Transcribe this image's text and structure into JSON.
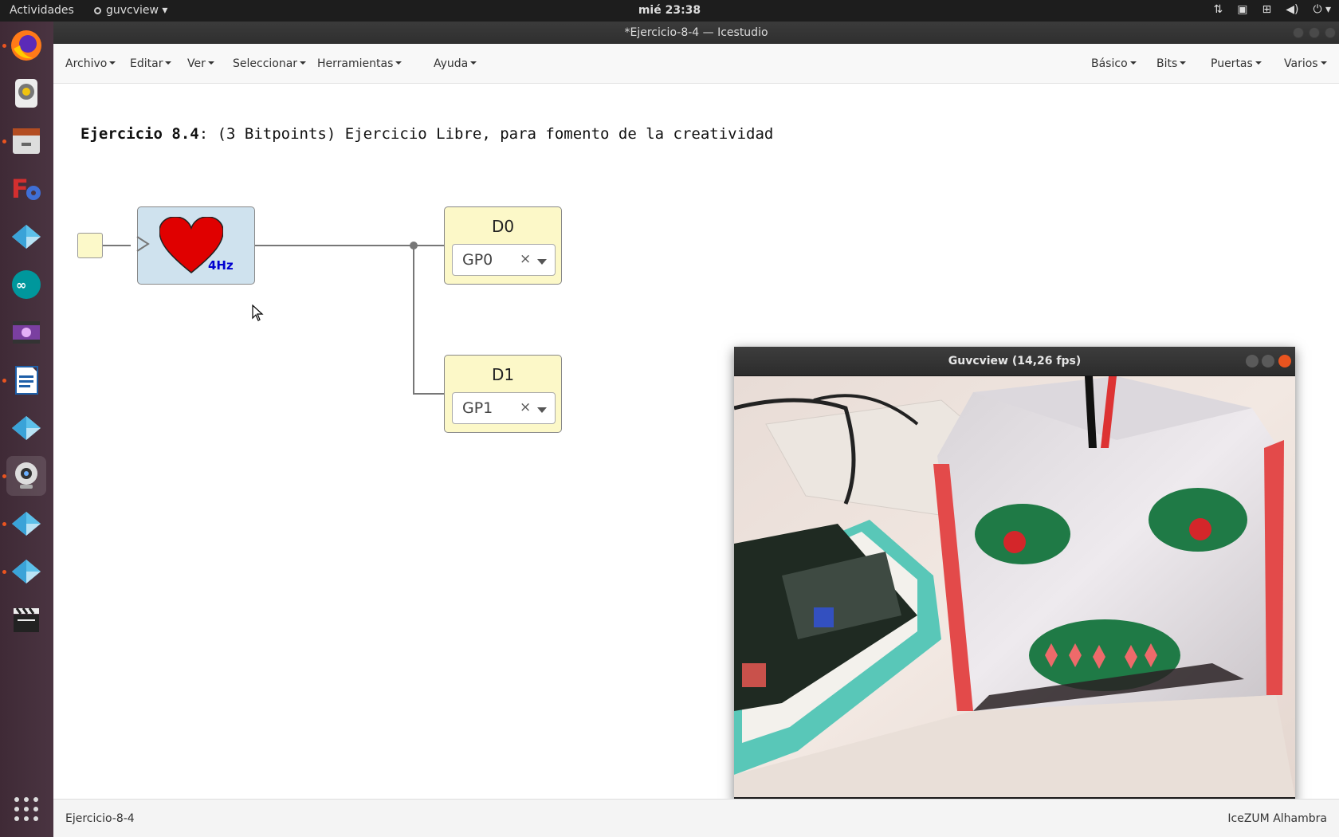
{
  "topbar": {
    "activities": "Actividades",
    "app_name": "guvcview",
    "clock": "mié 23:38",
    "tray_icons": [
      "network-transfer-icon",
      "camera-icon",
      "network-icon",
      "volume-icon",
      "power-icon"
    ]
  },
  "window": {
    "title": "*Ejercicio-8-4 — Icestudio"
  },
  "launcher": {
    "items": [
      {
        "name": "firefox-icon",
        "running": true
      },
      {
        "name": "rhythmbox-icon",
        "running": false
      },
      {
        "name": "files-icon",
        "running": true
      },
      {
        "name": "freecad-icon",
        "running": false
      },
      {
        "name": "icestudio-icon",
        "running": false
      },
      {
        "name": "arduino-icon",
        "running": false
      },
      {
        "name": "video-editor-icon",
        "running": false
      },
      {
        "name": "writer-icon",
        "running": true
      },
      {
        "name": "icestudio-icon",
        "running": false
      },
      {
        "name": "webcam-icon",
        "running": true
      },
      {
        "name": "icestudio-icon",
        "running": true
      },
      {
        "name": "icestudio-icon",
        "running": true
      },
      {
        "name": "clapper-icon",
        "running": false
      }
    ],
    "show_apps": "app-grid-icon"
  },
  "menu": {
    "left": [
      "Archivo",
      "Editar",
      "Ver",
      "Seleccionar",
      "Herramientas",
      "Ayuda"
    ],
    "right": [
      "Básico",
      "Bits",
      "Puertas",
      "Varios"
    ]
  },
  "canvas": {
    "heading_bold": "Ejercicio 8.4",
    "heading_rest": ": (3 Bitpoints) Ejercicio Libre, para fomento de la creatividad",
    "heart_freq": "4Hz",
    "outputs": [
      {
        "label": "D0",
        "pin": "GP0",
        "clear": "×"
      },
      {
        "label": "D1",
        "pin": "GP1",
        "clear": "×"
      }
    ]
  },
  "guvcview": {
    "title": "Guvcview  (14,26 fps)"
  },
  "status": {
    "left": "Ejercicio-8-4",
    "right": "IceZUM Alhambra"
  },
  "colors": {
    "orange_pip": "#e95420",
    "heart": "#e00000",
    "freq_text": "#0000d0",
    "block_blue": "#cfe2ee",
    "block_yellow": "#fcf8c8"
  }
}
